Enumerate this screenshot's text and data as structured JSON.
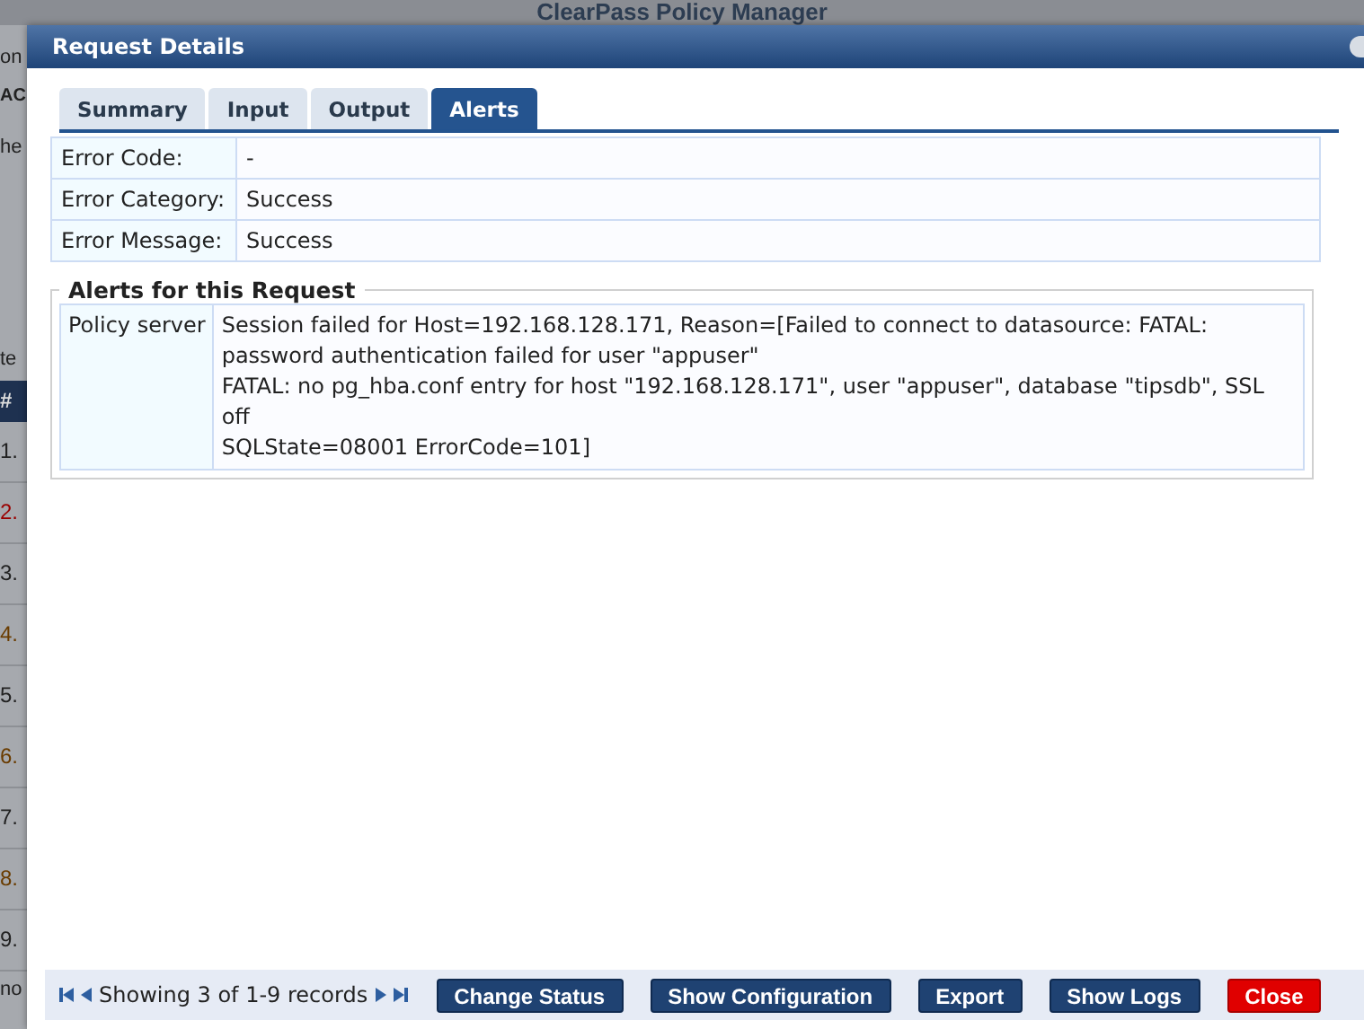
{
  "background": {
    "title": "ClearPass Policy Manager",
    "fragments": [
      "on",
      "AC",
      "he",
      "te"
    ],
    "table_header": "#",
    "rows": [
      {
        "number": "1.",
        "color": "#222222"
      },
      {
        "number": "2.",
        "color": "#9a0000"
      },
      {
        "number": "3.",
        "color": "#222222"
      },
      {
        "number": "4.",
        "color": "#6a3c00"
      },
      {
        "number": "5.",
        "color": "#222222"
      },
      {
        "number": "6.",
        "color": "#6a3c00"
      },
      {
        "number": "7.",
        "color": "#222222"
      },
      {
        "number": "8.",
        "color": "#6a3c00"
      },
      {
        "number": "9.",
        "color": "#222222"
      }
    ],
    "footer_fragment": "no"
  },
  "dialog": {
    "title": "Request Details",
    "tabs": [
      {
        "label": "Summary",
        "selected": false
      },
      {
        "label": "Input",
        "selected": false
      },
      {
        "label": "Output",
        "selected": false
      },
      {
        "label": "Alerts",
        "selected": true
      }
    ],
    "fields": [
      {
        "label": "Error Code:",
        "value": "-"
      },
      {
        "label": "Error Category:",
        "value": "Success"
      },
      {
        "label": "Error Message:",
        "value": "Success"
      }
    ],
    "alerts": {
      "legend": "Alerts for this Request",
      "rows": [
        {
          "source": "Policy server",
          "lines": [
            "Session failed for Host=192.168.128.171, Reason=[Failed to connect to datasource: FATAL: password authentication failed for user \"appuser\"",
            "FATAL: no pg_hba.conf entry for host \"192.168.128.171\", user \"appuser\", database \"tipsdb\", SSL off",
            "SQLState=08001 ErrorCode=101]"
          ]
        }
      ]
    },
    "footer": {
      "status": "Showing 3 of 1-9 records",
      "buttons": [
        {
          "label": "Change Status",
          "kind": "normal"
        },
        {
          "label": "Show Configuration",
          "kind": "normal"
        },
        {
          "label": "Export",
          "kind": "normal"
        },
        {
          "label": "Show Logs",
          "kind": "normal"
        },
        {
          "label": "Close",
          "kind": "danger"
        }
      ]
    }
  }
}
